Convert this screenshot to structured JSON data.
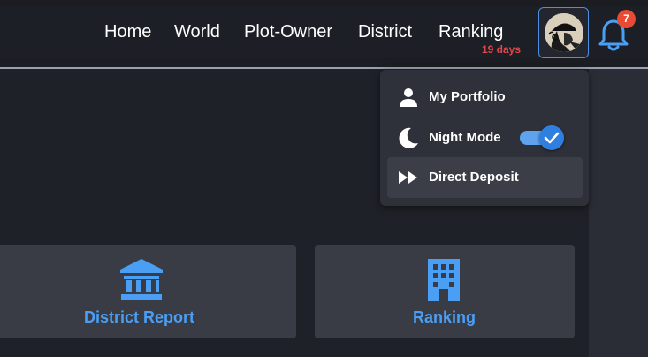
{
  "nav": {
    "items": [
      {
        "label": "Home"
      },
      {
        "label": "World"
      },
      {
        "label": "Plot-Owner"
      },
      {
        "label": "District"
      },
      {
        "label": "Ranking"
      }
    ],
    "ranking_sub": "19 days"
  },
  "notifications": {
    "count": "7",
    "icon": "bell-icon"
  },
  "user_menu": {
    "items": [
      {
        "label": "My Portfolio",
        "icon": "user-icon"
      },
      {
        "label": "Night Mode",
        "icon": "moon-icon",
        "toggle_on": true
      },
      {
        "label": "Direct Deposit",
        "icon": "fast-forward-icon"
      }
    ]
  },
  "cards": [
    {
      "label": "District Report",
      "icon": "bank-icon"
    },
    {
      "label": "Ranking",
      "icon": "building-icon"
    }
  ],
  "colors": {
    "accent": "#4a9ff5",
    "badge": "#e84a34",
    "days_text": "#e2464a",
    "background": "#1f2128"
  }
}
